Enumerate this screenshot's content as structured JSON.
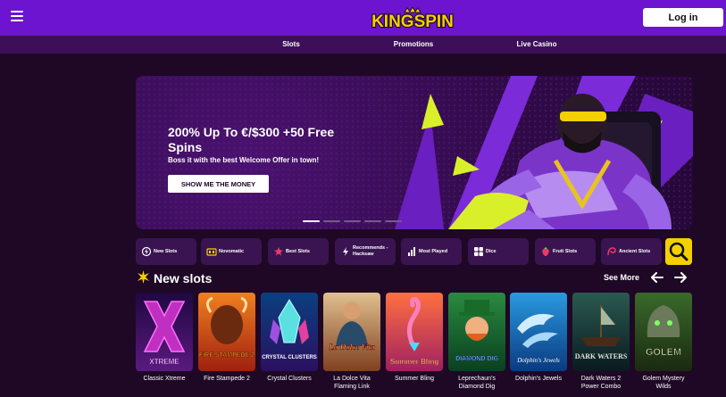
{
  "header": {
    "logo_text": "KINGSPIN",
    "login_label": "Log in"
  },
  "nav": {
    "items": [
      {
        "label": "Slots"
      },
      {
        "label": "Promotions"
      },
      {
        "label": "Live Casino"
      }
    ]
  },
  "hero": {
    "title": "200% Up To €/$300 +50 Free Spins",
    "subtitle": "Boss it with the best Welcome Offer in town!",
    "cta_label": "SHOW ME THE MONEY",
    "slides_total": 5,
    "active_slide": 1
  },
  "categories": [
    {
      "label": "New Slots",
      "icon": "flash-icon"
    },
    {
      "label": "Novomatic",
      "icon": "slot-machine-icon"
    },
    {
      "label": "Best Slots",
      "icon": "star-icon"
    },
    {
      "label": "Recommends - Hacksaw",
      "icon": "lightning-icon"
    },
    {
      "label": "Most Played",
      "icon": "bar-chart-icon"
    },
    {
      "label": "Dice",
      "icon": "dice-icon"
    },
    {
      "label": "Fruit Slots",
      "icon": "strawberry-icon"
    },
    {
      "label": "Ancient Slots",
      "icon": "ancient-icon"
    }
  ],
  "section": {
    "title": "New slots",
    "see_more_label": "See More"
  },
  "games": [
    {
      "name": "Classic Xtreme",
      "art_text": "XTREME"
    },
    {
      "name": "Fire Stampede 2",
      "art_text": "FIRE STAMPEDE 2"
    },
    {
      "name": "Crystal Clusters",
      "art_text": "CRYSTAL CLUSTERS"
    },
    {
      "name": "La Dolce Vita Flaming Link",
      "art_text": "La Dolce Vita"
    },
    {
      "name": "Summer Bling",
      "art_text": "Summer Bling"
    },
    {
      "name": "Leprechaun's Diamond Dig",
      "art_text": "DIAMOND DIG"
    },
    {
      "name": "Dolphin's Jewels",
      "art_text": "Dolphin's Jewels"
    },
    {
      "name": "Dark Waters 2 Power Combo",
      "art_text": "DARK WATERS"
    },
    {
      "name": "Golem Mystery Wilds",
      "art_text": "GOLEM"
    }
  ],
  "colors": {
    "header_bg": "#6d14d0",
    "nav_bg": "#3d0f58",
    "page_bg": "#1e0826",
    "accent_yellow": "#f5d000",
    "pill_bg": "#3a1450"
  }
}
